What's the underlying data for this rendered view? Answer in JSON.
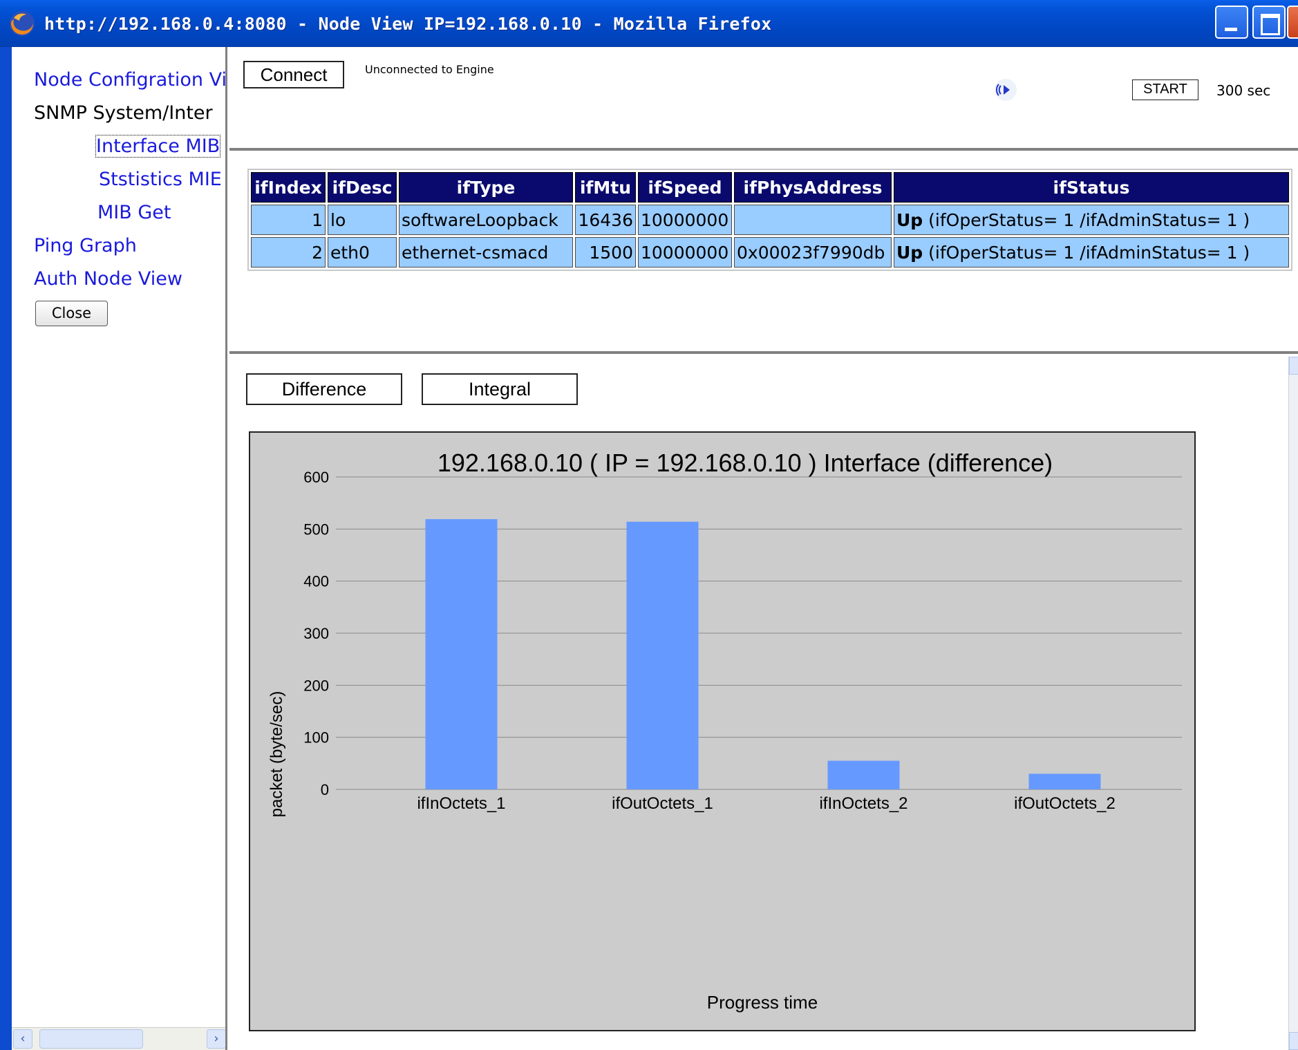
{
  "window": {
    "title": "http://192.168.0.4:8080 - Node View IP=192.168.0.10 - Mozilla Firefox"
  },
  "nav": {
    "items": [
      {
        "label": "Node Configration Vi"
      },
      {
        "label": "SNMP System/Inter"
      },
      {
        "label": "Interface MIB"
      },
      {
        "label": "Ststistics MIE"
      },
      {
        "label": "MIB Get"
      },
      {
        "label": "Ping Graph"
      },
      {
        "label": "Auth Node View"
      }
    ],
    "close_label": "Close"
  },
  "control": {
    "connect_label": "Connect",
    "status_text": "Unconnected to Engine",
    "start_label": "START",
    "interval_text": "300  sec"
  },
  "table": {
    "headers": [
      "ifIndex",
      "ifDesc",
      "ifType",
      "ifMtu",
      "ifSpeed",
      "ifPhysAddress",
      "ifStatus"
    ],
    "rows": [
      {
        "ifIndex": "1",
        "ifDesc": "lo",
        "ifType": "softwareLoopback",
        "ifMtu": "16436",
        "ifSpeed": "10000000",
        "ifPhysAddress": "",
        "status_word": "Up",
        "status_detail": " (ifOperStatus= 1 /ifAdminStatus= 1 )"
      },
      {
        "ifIndex": "2",
        "ifDesc": "eth0",
        "ifType": "ethernet-csmacd",
        "ifMtu": "1500",
        "ifSpeed": "10000000",
        "ifPhysAddress": "0x00023f7990db",
        "status_word": "Up",
        "status_detail": " (ifOperStatus= 1 /ifAdminStatus= 1 )"
      }
    ]
  },
  "graph_modes": {
    "difference_label": "Difference",
    "integral_label": "Integral"
  },
  "colors": {
    "bar": "#6699ff",
    "plot_bg": "#cccccc",
    "header_bg": "#0a0a6e",
    "row_bg": "#99ccff",
    "link": "#1a1adc"
  },
  "chart_data": {
    "type": "bar",
    "title": "192.168.0.10 ( IP = 192.168.0.10 ) Interface (difference)",
    "xlabel": "Progress time",
    "ylabel": "packet (byte/sec)",
    "categories": [
      "ifInOctets_1",
      "ifOutOctets_1",
      "ifInOctets_2",
      "ifOutOctets_2"
    ],
    "values": [
      519,
      514,
      55,
      30
    ],
    "ylim": [
      0,
      600
    ],
    "yticks": [
      "0",
      "100",
      "200",
      "300",
      "400",
      "500",
      "600"
    ],
    "grid": true,
    "legend": "none"
  }
}
